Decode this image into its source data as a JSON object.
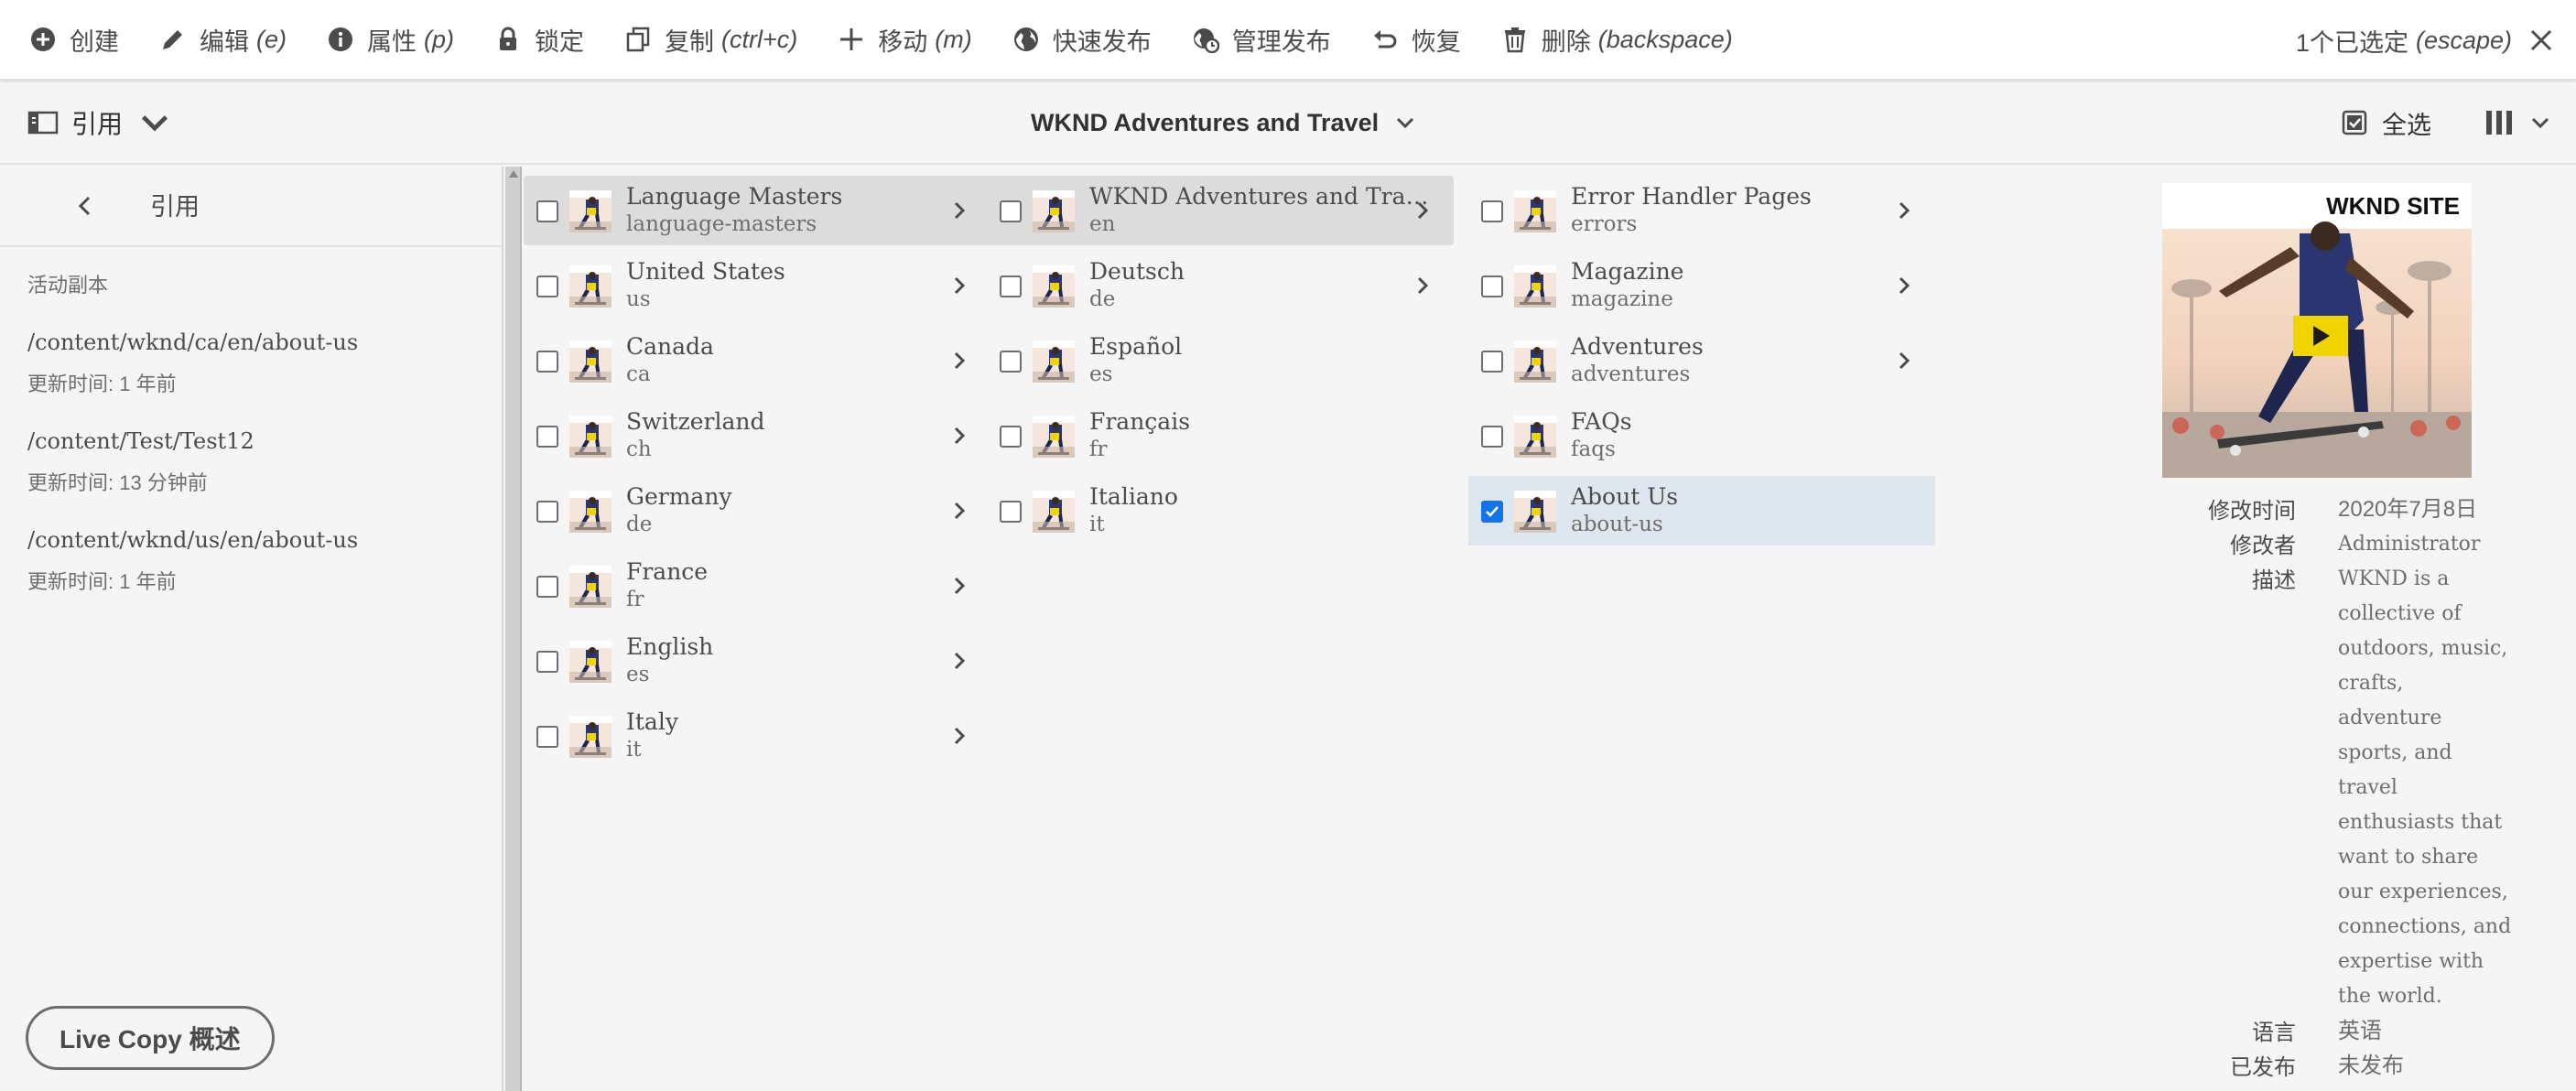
{
  "actionbar": {
    "create": {
      "label": "创建"
    },
    "edit": {
      "label": "编辑",
      "shortcut": "(e)"
    },
    "properties": {
      "label": "属性",
      "shortcut": "(p)"
    },
    "lock": {
      "label": "锁定"
    },
    "copy": {
      "label": "复制",
      "shortcut": "(ctrl+c)"
    },
    "move": {
      "label": "移动",
      "shortcut": "(m)"
    },
    "quick_publish": {
      "label": "快速发布"
    },
    "manage_publication": {
      "label": "管理发布"
    },
    "restore": {
      "label": "恢复"
    },
    "delete": {
      "label": "删除",
      "shortcut": "(backspace)"
    },
    "selection": {
      "label": "1个已选定",
      "shortcut": "(escape)"
    }
  },
  "subbar": {
    "rail_label": "引用",
    "title": "WKND Adventures and Travel",
    "select_all": "全选"
  },
  "rail": {
    "title": "引用",
    "section": "活动副本",
    "references": [
      {
        "path": "/content/wknd/ca/en/about-us",
        "updated": "更新时间: 1 年前"
      },
      {
        "path": "/content/Test/Test12",
        "updated": "更新时间: 13 分钟前"
      },
      {
        "path": "/content/wknd/us/en/about-us",
        "updated": "更新时间: 1 年前"
      }
    ],
    "live_copy_button": "Live Copy 概述"
  },
  "columns": [
    [
      {
        "title": "Language Masters",
        "name": "language-masters",
        "active": true,
        "children": true
      },
      {
        "title": "United States",
        "name": "us",
        "children": true
      },
      {
        "title": "Canada",
        "name": "ca",
        "children": true
      },
      {
        "title": "Switzerland",
        "name": "ch",
        "children": true
      },
      {
        "title": "Germany",
        "name": "de",
        "children": true
      },
      {
        "title": "France",
        "name": "fr",
        "children": true
      },
      {
        "title": "English",
        "name": "es",
        "children": true
      },
      {
        "title": "Italy",
        "name": "it",
        "children": true
      }
    ],
    [
      {
        "title": "WKND Adventures and Tra…",
        "name": "en",
        "active": true,
        "children": true
      },
      {
        "title": "Deutsch",
        "name": "de",
        "children": true
      },
      {
        "title": "Español",
        "name": "es",
        "children": false
      },
      {
        "title": "Français",
        "name": "fr",
        "children": false
      },
      {
        "title": "Italiano",
        "name": "it",
        "children": false
      }
    ],
    [
      {
        "title": "Error Handler Pages",
        "name": "errors",
        "children": true
      },
      {
        "title": "Magazine",
        "name": "magazine",
        "children": true
      },
      {
        "title": "Adventures",
        "name": "adventures",
        "children": true
      },
      {
        "title": "FAQs",
        "name": "faqs",
        "children": false
      },
      {
        "title": "About Us",
        "name": "about-us",
        "children": false,
        "selected": true
      }
    ]
  ],
  "preview": {
    "logo_text": "WKND SITE",
    "modified_label": "修改时间",
    "modified_value": "2020年7月8日",
    "modifier_label": "修改者",
    "modifier_value": "Administrator",
    "description_label": "描述",
    "description_lines": [
      "WKND is a",
      "collective of",
      "outdoors, music,",
      "crafts,",
      "adventure",
      "sports, and",
      "travel",
      "enthusiasts that",
      "want to share",
      "our experiences,",
      "connections, and",
      "expertise with",
      "the world."
    ],
    "language_label": "语言",
    "language_value": "英语",
    "published_label": "已发布",
    "published_value": "未发布"
  },
  "colors": {
    "accent": "#1473e6",
    "selected_row": "#dee6ef",
    "active_row": "#dcdcdc"
  }
}
